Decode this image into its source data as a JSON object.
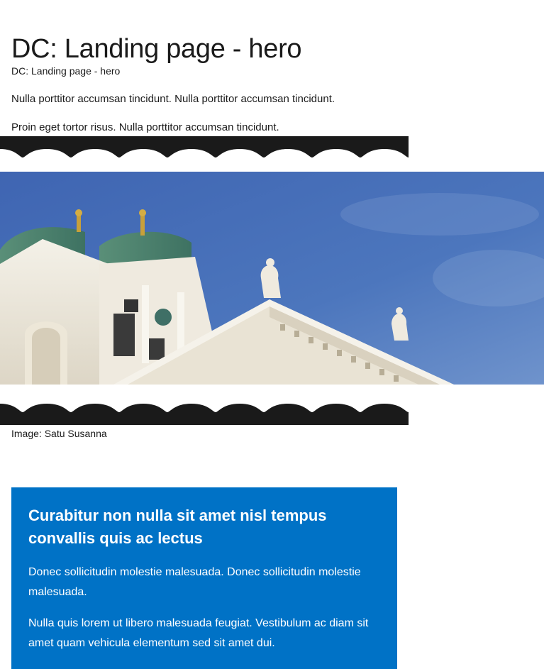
{
  "page": {
    "title": "DC: Landing page - hero",
    "subtitle": "DC: Landing page - hero",
    "paragraphs": [
      "Nulla porttitor accumsan tincidunt. Nulla porttitor accumsan tincidunt.",
      "Proin eget tortor risus. Nulla porttitor accumsan tincidunt."
    ]
  },
  "hero": {
    "caption": "Image: Satu Susanna",
    "wave_color": "#1a1a1a",
    "sky_color": "#4a72b8"
  },
  "info_box": {
    "heading": "Curabitur non nulla sit amet nisl tempus convallis quis ac lectus",
    "paragraphs": [
      "Donec sollicitudin molestie malesuada. Donec sollicitudin molestie malesuada.",
      "Nulla quis lorem ut libero malesuada feugiat. Vestibulum ac diam sit amet quam vehicula elementum sed sit amet dui."
    ],
    "background_color": "#0072c6"
  }
}
